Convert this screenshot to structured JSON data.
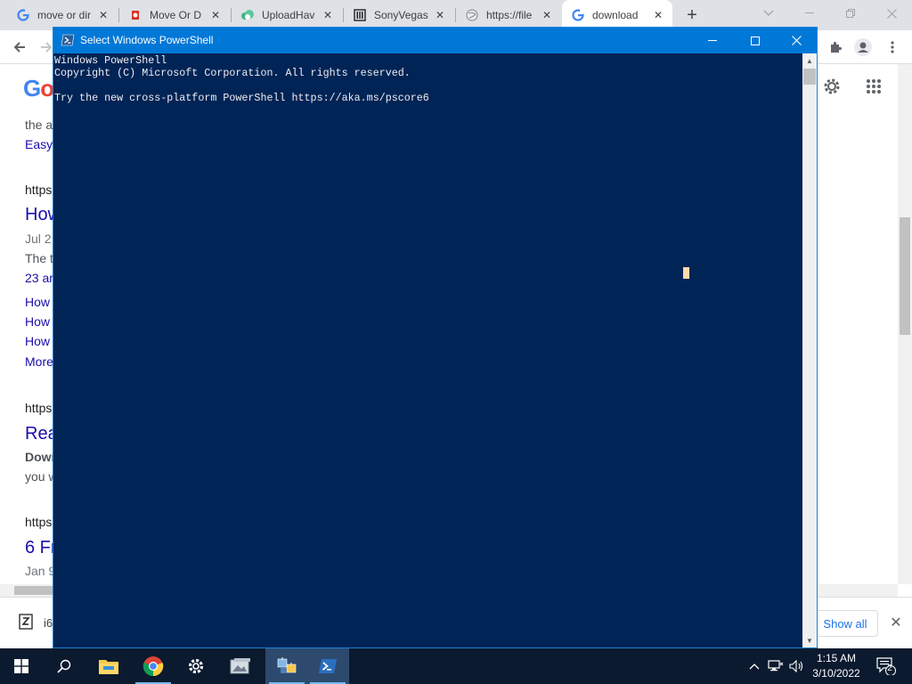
{
  "browser": {
    "tabs": [
      {
        "title": "move or dir",
        "favicon": "google-icon"
      },
      {
        "title": "Move Or D",
        "favicon": "red-app-icon"
      },
      {
        "title": "UploadHav",
        "favicon": "cloud-icon"
      },
      {
        "title": "SonyVegas",
        "favicon": "columns-icon"
      },
      {
        "title": "https://file",
        "favicon": "globe-icon"
      },
      {
        "title": "download",
        "favicon": "google-icon"
      }
    ],
    "new_tab_label": "+"
  },
  "google_page": {
    "logo_letters": [
      "G",
      "o"
    ],
    "results": [
      {
        "line1": "the a",
        "line2": "Easy"
      },
      {
        "url": "https",
        "title": "How",
        "date": "Jul 2",
        "snippet1": "The t",
        "snippet2": "23 ar",
        "sublinks": [
          "How",
          "How",
          "How"
        ],
        "more": "More"
      },
      {
        "url": "https",
        "title": "Rea",
        "bold": "Down",
        "snippet": "you w"
      },
      {
        "url": "https",
        "title": "6 Fr",
        "date": "Jan 9"
      }
    ]
  },
  "download_bar": {
    "item_name": "i6",
    "show_all_label": "Show all"
  },
  "powershell": {
    "window_title": "Select Windows PowerShell",
    "console_lines": [
      "Windows PowerShell",
      "Copyright (C) Microsoft Corporation. All rights reserved.",
      "",
      "Try the new cross-platform PowerShell https://aka.ms/pscore6"
    ],
    "colors": {
      "background": "#012456",
      "text": "#eeedf0",
      "cursor": "#fedba9",
      "title_bar": "#0078d7"
    }
  },
  "taskbar": {
    "icons": [
      "windows-start-icon",
      "search-icon",
      "file-explorer-icon",
      "chrome-icon",
      "settings-icon",
      "photos-app-icon",
      "network-app-icon",
      "powershell-icon"
    ],
    "clock_time": "1:15 AM",
    "clock_date": "3/10/2022",
    "notification_count": "2"
  }
}
